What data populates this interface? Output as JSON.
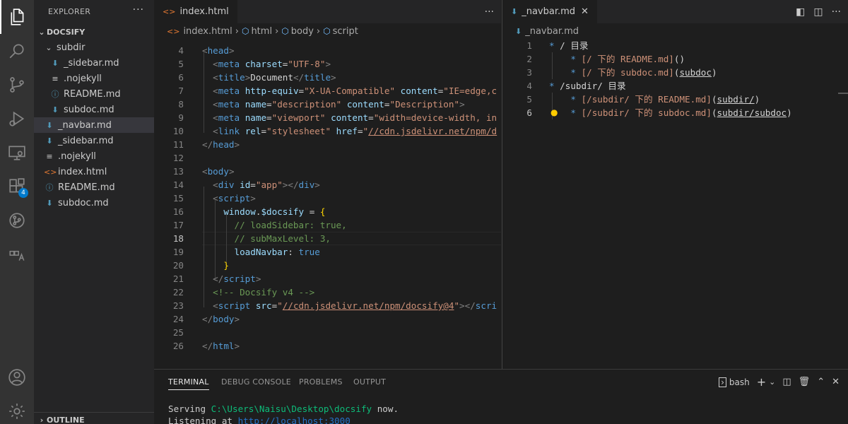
{
  "activity_bar": {
    "extensions_badge": "4"
  },
  "sidebar": {
    "title": "EXPLORER",
    "more": "···",
    "root": "DOCSIFY",
    "tree": [
      {
        "label": "subdir",
        "type": "folder",
        "indent": 1
      },
      {
        "label": "_sidebar.md",
        "type": "md",
        "indent": 2
      },
      {
        "label": ".nojekyll",
        "type": "plain",
        "indent": 2
      },
      {
        "label": "README.md",
        "type": "info",
        "indent": 2
      },
      {
        "label": "subdoc.md",
        "type": "md",
        "indent": 2
      },
      {
        "label": "_navbar.md",
        "type": "md",
        "indent": 1,
        "selected": true
      },
      {
        "label": "_sidebar.md",
        "type": "md",
        "indent": 1
      },
      {
        "label": ".nojekyll",
        "type": "plain",
        "indent": 1
      },
      {
        "label": "index.html",
        "type": "html",
        "indent": 1
      },
      {
        "label": "README.md",
        "type": "info",
        "indent": 1
      },
      {
        "label": "subdoc.md",
        "type": "md",
        "indent": 1
      }
    ],
    "outline": "OUTLINE"
  },
  "left_editor": {
    "tab": "index.html",
    "more": "···",
    "breadcrumb": [
      "index.html",
      "html",
      "body",
      "script"
    ],
    "line_numbers": [
      "4",
      "5",
      "6",
      "7",
      "8",
      "9",
      "10",
      "11",
      "12",
      "13",
      "14",
      "15",
      "16",
      "17",
      "18",
      "19",
      "20",
      "21",
      "22",
      "23",
      "24",
      "25",
      "26"
    ],
    "current_line": "18"
  },
  "right_editor": {
    "tab": "_navbar.md",
    "breadcrumb": "_navbar.md",
    "line_numbers": [
      "1",
      "2",
      "3",
      "4",
      "5",
      "6"
    ],
    "current_line": "6"
  },
  "panel": {
    "tabs": [
      "TERMINAL",
      "DEBUG CONSOLE",
      "PROBLEMS",
      "OUTPUT"
    ],
    "shell": "bash",
    "terminal": {
      "line1_prefix": "Serving ",
      "line1_path": "C:\\Users\\Naisu\\Desktop\\docsify",
      "line1_suffix": " now.",
      "line2_prefix": "Listening at ",
      "line2_url": "http://localhost:3000"
    }
  }
}
